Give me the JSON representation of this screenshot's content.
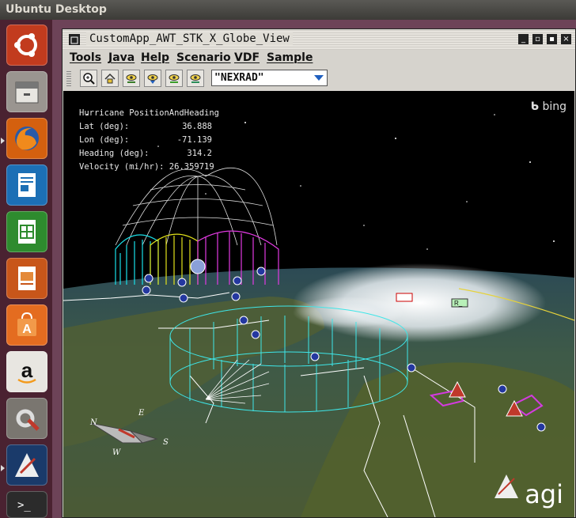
{
  "topbar": {
    "title": "Ubuntu Desktop"
  },
  "launcher": {
    "items": [
      {
        "name": "ubuntu-dash-icon"
      },
      {
        "name": "file-cabinet-icon"
      },
      {
        "name": "firefox-icon"
      },
      {
        "name": "writer-icon"
      },
      {
        "name": "calc-icon"
      },
      {
        "name": "impress-icon"
      },
      {
        "name": "software-center-icon"
      },
      {
        "name": "amazon-icon"
      },
      {
        "name": "system-settings-icon"
      },
      {
        "name": "stk-app-icon"
      },
      {
        "name": "terminal-icon"
      }
    ]
  },
  "window": {
    "title": "CustomApp_AWT_STK_X_Globe_View",
    "menus": [
      "Tools",
      "Java",
      "Help",
      "Scenario",
      "VDF",
      "Sample"
    ],
    "toolbar": {
      "buttons": [
        "zoom-icon",
        "home-view-icon",
        "view-eye-icon-1",
        "view-eye-icon-2",
        "view-eye-icon-3",
        "view-eye-icon-4"
      ],
      "combo_value": "\"NEXRAD\""
    }
  },
  "hud": {
    "title": "Hurricane PositionAndHeading",
    "lat_label": "Lat (deg):",
    "lat_value": "36.888",
    "lon_label": "Lon (deg):",
    "lon_value": "-71.139",
    "heading_label": "Heading (deg):",
    "heading_value": "314.2",
    "velocity_label": "Velocity (mi/hr):",
    "velocity_value": "26.359719"
  },
  "map": {
    "bing_label": "bing",
    "agi_label": "agi",
    "sat_label": "R_",
    "compass": {
      "n": "N",
      "e": "E",
      "s": "S",
      "w": "W"
    }
  }
}
